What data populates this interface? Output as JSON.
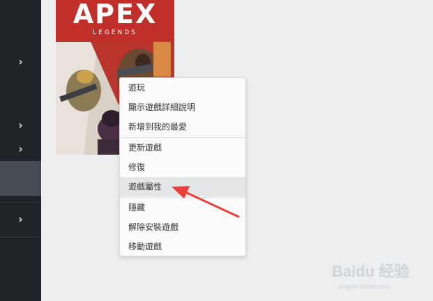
{
  "sidebar": {
    "expanders": [
      "›",
      "›",
      "›",
      "›"
    ]
  },
  "cover": {
    "title": "APEX",
    "subtitle": "LEGENDS"
  },
  "context_menu": {
    "group1": [
      "遊玩",
      "顯示遊戲詳細說明",
      "新增到我的最愛"
    ],
    "group2": [
      "更新遊戲",
      "修復",
      "遊戲屬性"
    ],
    "group3": [
      "隱藏",
      "解除安裝遊戲",
      "移動遊戲"
    ],
    "highlighted": "遊戲屬性"
  },
  "annotation": {
    "arrow_color": "#e8403a"
  },
  "watermark": {
    "brand": "Baidu 经验",
    "url": "jingyan.baidu.com"
  }
}
